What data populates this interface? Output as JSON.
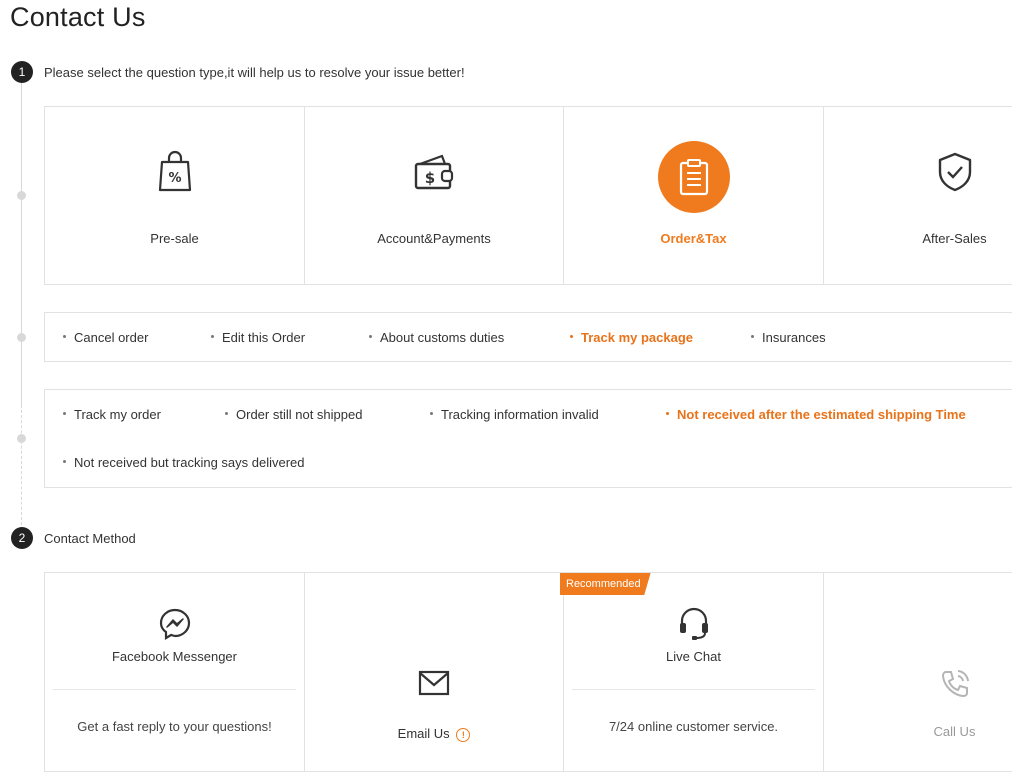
{
  "page": {
    "title": "Contact Us"
  },
  "step1": {
    "number": "1",
    "instruction": "Please select the question type,it will help us to resolve your issue better!",
    "categories": [
      {
        "label": "Pre-sale",
        "icon": "shopping-bag-percent-icon",
        "active": false
      },
      {
        "label": "Account&Payments",
        "icon": "wallet-dollar-icon",
        "active": false
      },
      {
        "label": "Order&Tax",
        "icon": "clipboard-icon",
        "active": true
      },
      {
        "label": "After-Sales",
        "icon": "shield-check-icon",
        "active": false
      }
    ],
    "subtopics": [
      {
        "label": "Cancel order",
        "active": false
      },
      {
        "label": "Edit this Order",
        "active": false
      },
      {
        "label": "About customs duties",
        "active": false
      },
      {
        "label": "Track my package",
        "active": true
      },
      {
        "label": "Insurances",
        "active": false
      }
    ],
    "issues": [
      {
        "label": "Track my order",
        "active": false
      },
      {
        "label": "Order still not shipped",
        "active": false
      },
      {
        "label": "Tracking information invalid",
        "active": false
      },
      {
        "label": "Not received after the estimated shipping Time",
        "active": true
      },
      {
        "label": "Not received but tracking says delivered",
        "active": false
      }
    ]
  },
  "step2": {
    "number": "2",
    "heading": "Contact Method",
    "methods": [
      {
        "label": "Facebook Messenger",
        "description": "Get a fast reply to your questions!",
        "icon": "messenger-icon"
      },
      {
        "label": "Email Us",
        "icon": "envelope-icon",
        "info_icon": "info-icon"
      },
      {
        "label": "Live Chat",
        "description": "7/24 online customer service.",
        "badge": "Recommended",
        "icon": "headset-icon"
      },
      {
        "label": "Call Us",
        "icon": "phone-icon",
        "disabled": true
      }
    ]
  },
  "colors": {
    "accent": "#f07b1e",
    "text": "#333333",
    "border": "#e2e2e2",
    "disabled": "#999999"
  }
}
